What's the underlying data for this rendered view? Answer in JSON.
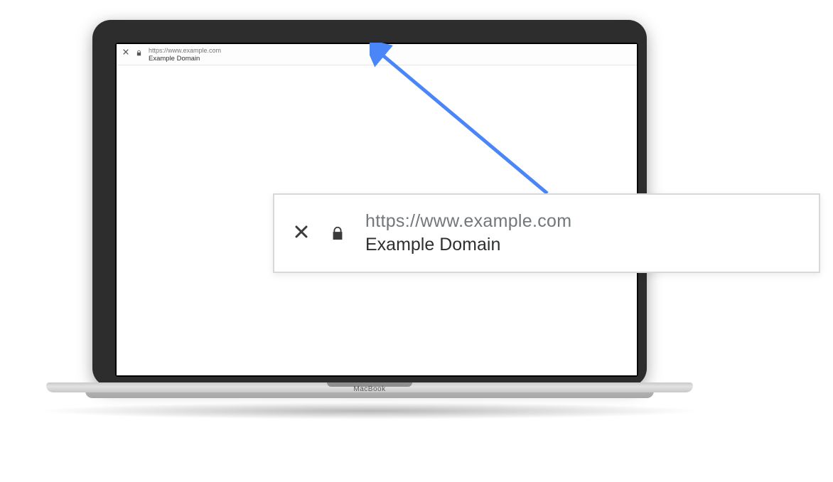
{
  "browser": {
    "url": "https://www.example.com",
    "page_title": "Example Domain"
  },
  "callout": {
    "url": "https://www.example.com",
    "page_title": "Example Domain"
  },
  "device": {
    "brand": "MacBook"
  }
}
